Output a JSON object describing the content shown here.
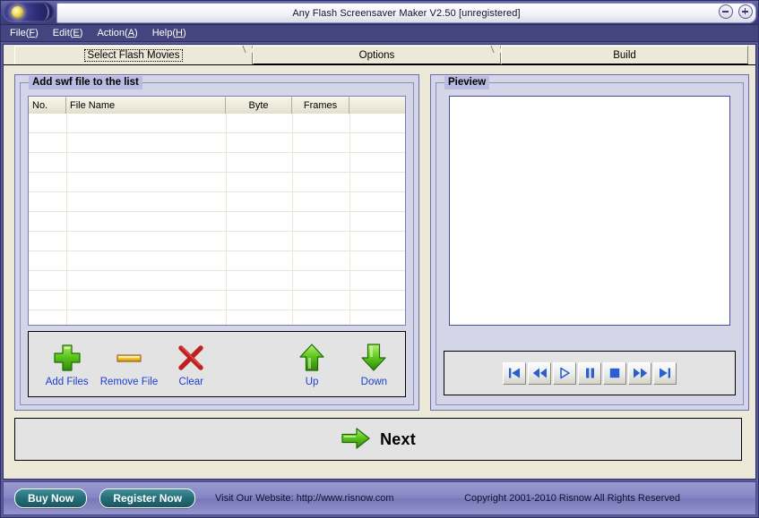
{
  "window": {
    "title": "Any Flash Screensaver Maker V2.50 [unregistered]",
    "logo_icon": "glowing-orb-logo",
    "buttons": [
      {
        "name": "minimize",
        "icon": "minus-circle-icon"
      },
      {
        "name": "maximize",
        "icon": "plus-circle-icon"
      }
    ]
  },
  "menubar": {
    "items": [
      {
        "label": "File(F)",
        "pre": "File(",
        "accel": "F",
        "post": ")"
      },
      {
        "label": "Edit(E)",
        "pre": "Edit(",
        "accel": "E",
        "post": ")"
      },
      {
        "label": "Action(A)",
        "pre": "Action(",
        "accel": "A",
        "post": ")"
      },
      {
        "label": "Help(H)",
        "pre": "Help(",
        "accel": "H",
        "post": ")"
      }
    ]
  },
  "tabs": [
    {
      "label": "Select Flash Movies",
      "active": true
    },
    {
      "label": "Options",
      "active": false
    },
    {
      "label": "Build",
      "active": false
    }
  ],
  "left_panel": {
    "group_label": "Add swf file to the list",
    "list": {
      "columns": [
        "No.",
        "File Name",
        "Byte",
        "Frames",
        ""
      ],
      "rows": []
    },
    "toolbar": [
      {
        "label": "Add Files",
        "icon": "green-plus-icon"
      },
      {
        "label": "Remove File",
        "icon": "yellow-minus-icon"
      },
      {
        "label": "Clear",
        "icon": "red-x-icon"
      },
      {
        "label": "Up",
        "icon": "green-up-arrow-icon"
      },
      {
        "label": "Down",
        "icon": "green-down-arrow-icon"
      }
    ]
  },
  "right_panel": {
    "group_label": "Pieview",
    "media_buttons": [
      {
        "name": "skip-back",
        "icon": "skip-back-icon"
      },
      {
        "name": "rewind",
        "icon": "rewind-icon"
      },
      {
        "name": "play",
        "icon": "play-icon"
      },
      {
        "name": "pause",
        "icon": "pause-icon"
      },
      {
        "name": "stop",
        "icon": "stop-icon"
      },
      {
        "name": "fast-forward",
        "icon": "fast-forward-icon"
      },
      {
        "name": "skip-forward",
        "icon": "skip-forward-icon"
      }
    ]
  },
  "next_bar": {
    "label": "Next",
    "icon": "green-right-arrow-icon"
  },
  "statusbar": {
    "buy_label": "Buy Now",
    "register_label": "Register Now",
    "website": "Visit Our Website: http://www.risnow.com",
    "copyright": "Copyright 2001-2010 Risnow All Rights Reserved"
  },
  "colors": {
    "titlebar": "#44447f",
    "panel": "#d5d5e8",
    "client": "#ece9d8",
    "accent_blue": "#1a3fcf",
    "icon_green": "#4cb515",
    "icon_red": "#cc2020",
    "icon_yellow": "#e8b830",
    "media_blue": "#2a5fd0",
    "pill_teal": "#246d78"
  }
}
